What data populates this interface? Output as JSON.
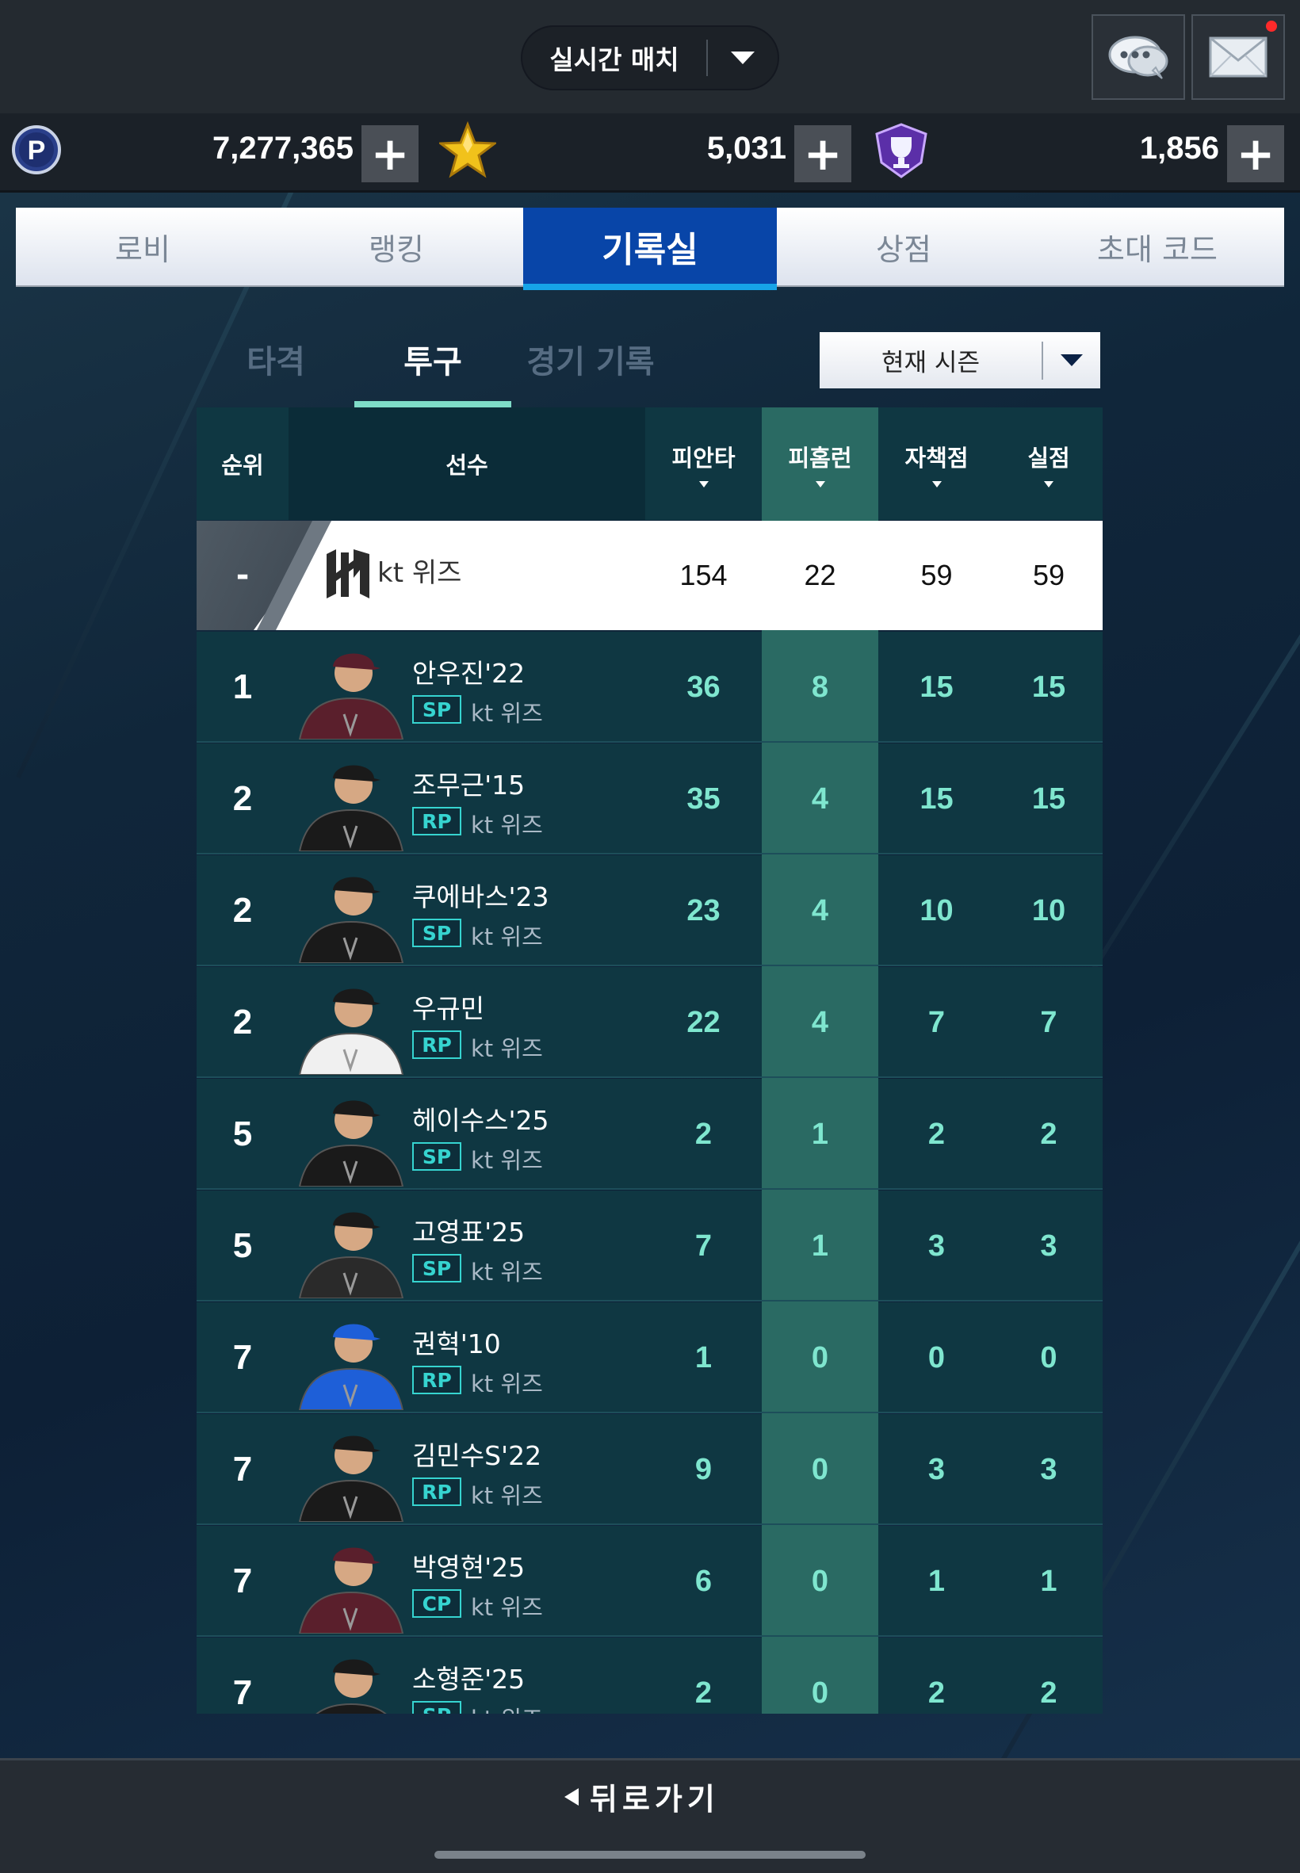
{
  "topbar": {
    "mode_label": "실시간 매치"
  },
  "currency": [
    {
      "icon": "p-coin-icon",
      "value": "7,277,365"
    },
    {
      "icon": "star-icon",
      "value": "5,031"
    },
    {
      "icon": "trophy-shield-icon",
      "value": "1,856"
    }
  ],
  "nav_tabs": [
    "로비",
    "랭킹",
    "기록실",
    "상점",
    "초대 코드"
  ],
  "nav_active": "기록실",
  "sub_tabs": [
    "타격",
    "투구",
    "경기 기록"
  ],
  "sub_active": "투구",
  "season_select": "현재 시즌",
  "table": {
    "headers": {
      "rank": "순위",
      "player": "선수",
      "hits_allowed": "피안타",
      "hr_allowed": "피홈런",
      "earned_runs": "자책점",
      "runs": "실점"
    },
    "team_row": {
      "rank": "-",
      "name": "kt 위즈",
      "hits_allowed": "154",
      "hr_allowed": "22",
      "earned_runs": "59",
      "runs": "59"
    },
    "rows": [
      {
        "rank": "1",
        "name": "안우진'22",
        "pos": "SP",
        "team": "kt 위즈",
        "hits_allowed": "36",
        "hr_allowed": "8",
        "earned_runs": "15",
        "runs": "15"
      },
      {
        "rank": "2",
        "name": "조무근'15",
        "pos": "RP",
        "team": "kt 위즈",
        "hits_allowed": "35",
        "hr_allowed": "4",
        "earned_runs": "15",
        "runs": "15"
      },
      {
        "rank": "2",
        "name": "쿠에바스'23",
        "pos": "SP",
        "team": "kt 위즈",
        "hits_allowed": "23",
        "hr_allowed": "4",
        "earned_runs": "10",
        "runs": "10"
      },
      {
        "rank": "2",
        "name": "우규민",
        "pos": "RP",
        "team": "kt 위즈",
        "hits_allowed": "22",
        "hr_allowed": "4",
        "earned_runs": "7",
        "runs": "7"
      },
      {
        "rank": "5",
        "name": "헤이수스'25",
        "pos": "SP",
        "team": "kt 위즈",
        "hits_allowed": "2",
        "hr_allowed": "1",
        "earned_runs": "2",
        "runs": "2"
      },
      {
        "rank": "5",
        "name": "고영표'25",
        "pos": "SP",
        "team": "kt 위즈",
        "hits_allowed": "7",
        "hr_allowed": "1",
        "earned_runs": "3",
        "runs": "3"
      },
      {
        "rank": "7",
        "name": "권혁'10",
        "pos": "RP",
        "team": "kt 위즈",
        "hits_allowed": "1",
        "hr_allowed": "0",
        "earned_runs": "0",
        "runs": "0"
      },
      {
        "rank": "7",
        "name": "김민수S'22",
        "pos": "RP",
        "team": "kt 위즈",
        "hits_allowed": "9",
        "hr_allowed": "0",
        "earned_runs": "3",
        "runs": "3"
      },
      {
        "rank": "7",
        "name": "박영현'25",
        "pos": "CP",
        "team": "kt 위즈",
        "hits_allowed": "6",
        "hr_allowed": "0",
        "earned_runs": "1",
        "runs": "1"
      },
      {
        "rank": "7",
        "name": "소형준'25",
        "pos": "SP",
        "team": "kt 위즈",
        "hits_allowed": "2",
        "hr_allowed": "0",
        "earned_runs": "2",
        "runs": "2"
      }
    ]
  },
  "bottom": {
    "back_label": "뒤로가기"
  },
  "colors": {
    "accent_blue": "#0845a8",
    "highlight_column": "#2a6a63",
    "stat_text": "#7fe6cf",
    "badge": "#36d4d0"
  }
}
